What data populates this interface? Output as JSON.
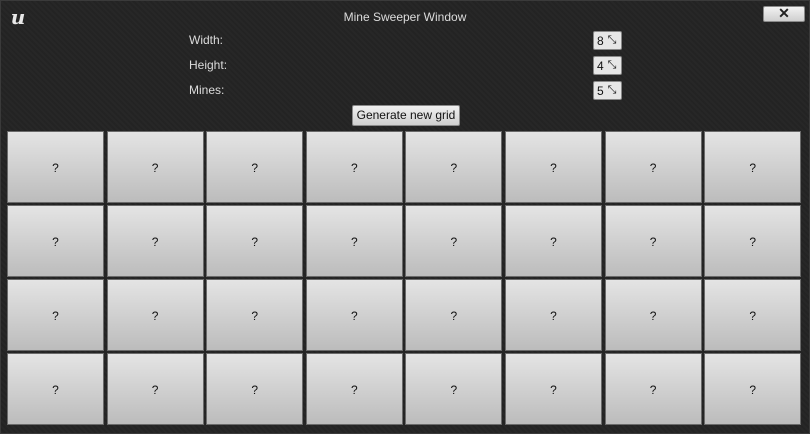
{
  "window": {
    "title": "Mine Sweeper Window",
    "logo_text": "u",
    "close_label": "✕"
  },
  "settings": [
    {
      "label": "Width:",
      "value": "8"
    },
    {
      "label": "Height:",
      "value": "4"
    },
    {
      "label": "Mines:",
      "value": "5"
    }
  ],
  "spinner_icon": "⤡",
  "generate_label": "Generate new grid",
  "grid": {
    "columns": 8,
    "rows": 4,
    "cell_label": "?"
  }
}
